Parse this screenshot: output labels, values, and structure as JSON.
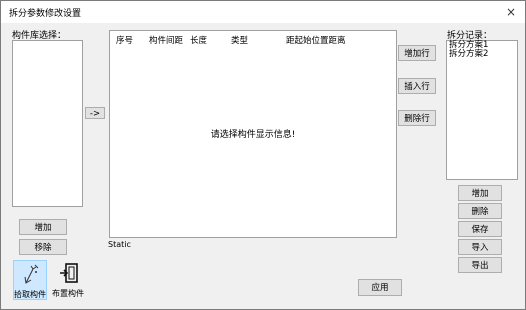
{
  "window": {
    "title": "拆分参数修改设置",
    "close": "×"
  },
  "left": {
    "label": "构件库选择：",
    "add": "增加",
    "remove": "移除"
  },
  "arrow_button": "->",
  "grid": {
    "columns": [
      "序号",
      "构件间距",
      "长度",
      "类型",
      "距起始位置距离"
    ],
    "empty_message": "请选择构件显示信息!"
  },
  "static_text": "Static",
  "row_actions": {
    "add_row": "增加行",
    "insert_row": "插入行",
    "delete_row": "删除行"
  },
  "records": {
    "label": "拆分记录：",
    "items": [
      "拆分方案1",
      "拆分方案2"
    ],
    "add": "增加",
    "delete": "删除",
    "save": "保存",
    "import": "导入",
    "export": "导出"
  },
  "apply": "应用",
  "tools": {
    "pick": "拾取构件",
    "layout": "布置构件"
  }
}
